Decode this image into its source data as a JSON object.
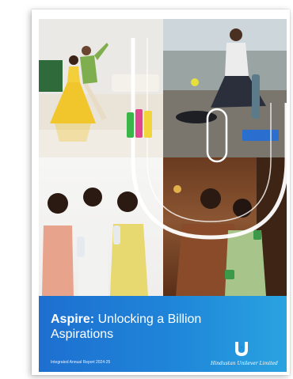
{
  "cover": {
    "title_bold": "Aspire:",
    "title_rest": " Unlocking a Billion Aspirations",
    "subtitle": "Integrated Annual Report 2024-25",
    "company": "Hindustan Unilever Limited",
    "logo_icon": "unilever-u-logo-icon",
    "band_color": "#1f86d9"
  }
}
